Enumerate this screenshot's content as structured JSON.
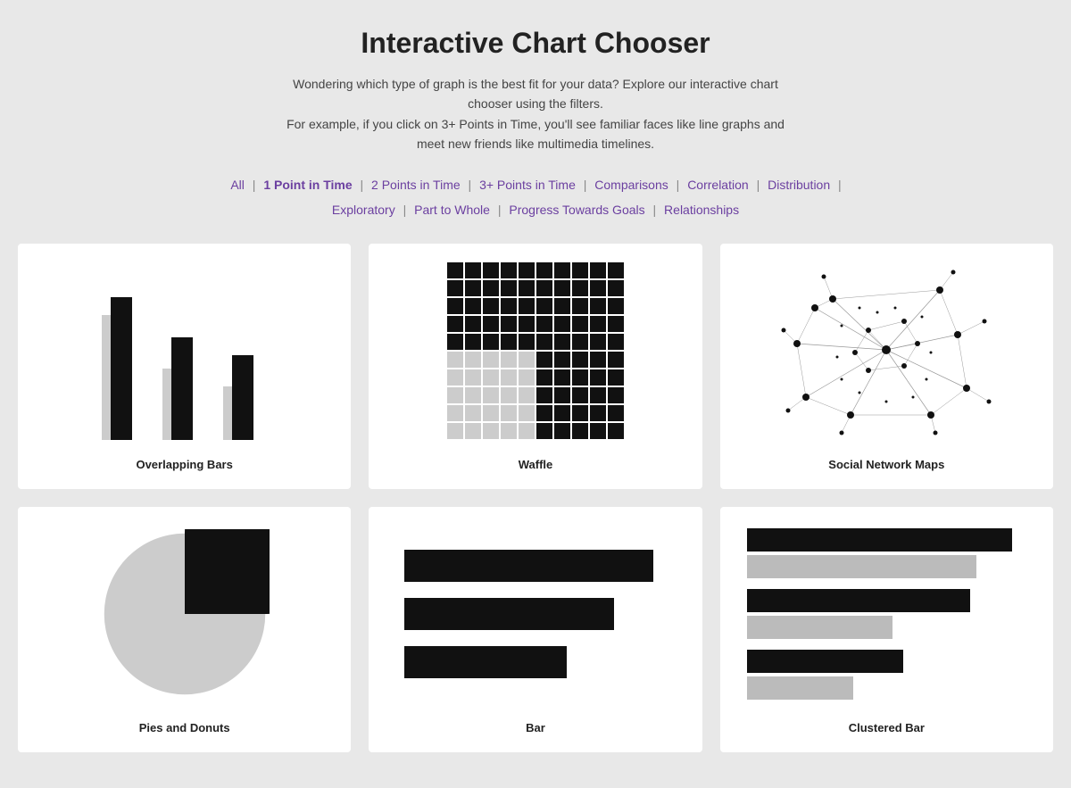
{
  "header": {
    "title": "Interactive Chart Chooser",
    "description_line1": "Wondering which type of graph is the best fit for your data? Explore our interactive chart chooser using the filters.",
    "description_line2": "For example, if you click on 3+ Points in Time, you'll see familiar faces like line graphs and meet new friends like multimedia timelines."
  },
  "filters": {
    "items": [
      {
        "label": "All",
        "active": false
      },
      {
        "label": "1 Point in Time",
        "active": true
      },
      {
        "label": "2 Points in Time",
        "active": false
      },
      {
        "label": "3+ Points in Time",
        "active": false
      },
      {
        "label": "Comparisons",
        "active": false
      },
      {
        "label": "Correlation",
        "active": false
      },
      {
        "label": "Distribution",
        "active": false
      },
      {
        "label": "Exploratory",
        "active": false
      },
      {
        "label": "Part to Whole",
        "active": false
      },
      {
        "label": "Progress Towards Goals",
        "active": false
      },
      {
        "label": "Relationships",
        "active": false
      }
    ]
  },
  "charts": [
    {
      "id": "overlapping-bars",
      "label": "Overlapping Bars"
    },
    {
      "id": "waffle",
      "label": "Waffle"
    },
    {
      "id": "social-network-maps",
      "label": "Social Network Maps"
    },
    {
      "id": "pies-and-donuts",
      "label": "Pies and Donuts"
    },
    {
      "id": "bar",
      "label": "Bar"
    },
    {
      "id": "clustered-bar",
      "label": "Clustered Bar"
    }
  ],
  "overlapping_bars": [
    {
      "back_height": 140,
      "front_height": 160
    },
    {
      "back_height": 80,
      "front_height": 110
    },
    {
      "back_height": 60,
      "front_height": 90
    }
  ],
  "waffle": {
    "filled_cells": [
      [
        0,
        0
      ],
      [
        0,
        1
      ],
      [
        0,
        2
      ],
      [
        0,
        3
      ],
      [
        0,
        4
      ],
      [
        0,
        5
      ],
      [
        0,
        6
      ],
      [
        0,
        7
      ],
      [
        0,
        8
      ],
      [
        0,
        9
      ],
      [
        1,
        0
      ],
      [
        1,
        1
      ],
      [
        1,
        2
      ],
      [
        1,
        3
      ],
      [
        1,
        4
      ],
      [
        1,
        5
      ],
      [
        1,
        6
      ],
      [
        1,
        7
      ],
      [
        1,
        8
      ],
      [
        1,
        9
      ],
      [
        2,
        0
      ],
      [
        2,
        1
      ],
      [
        2,
        2
      ],
      [
        2,
        3
      ],
      [
        2,
        4
      ],
      [
        2,
        5
      ],
      [
        2,
        6
      ],
      [
        2,
        7
      ],
      [
        2,
        8
      ],
      [
        2,
        9
      ],
      [
        3,
        0
      ],
      [
        3,
        1
      ],
      [
        3,
        2
      ],
      [
        3,
        3
      ],
      [
        3,
        4
      ],
      [
        3,
        5
      ],
      [
        3,
        6
      ],
      [
        3,
        7
      ],
      [
        3,
        8
      ],
      [
        3,
        9
      ],
      [
        4,
        0
      ],
      [
        4,
        1
      ],
      [
        4,
        2
      ],
      [
        4,
        3
      ],
      [
        4,
        4
      ],
      [
        4,
        5
      ],
      [
        4,
        6
      ],
      [
        4,
        7
      ],
      [
        4,
        8
      ],
      [
        4,
        9
      ],
      [
        5,
        5
      ],
      [
        5,
        6
      ],
      [
        5,
        7
      ],
      [
        5,
        8
      ],
      [
        5,
        9
      ],
      [
        6,
        5
      ],
      [
        6,
        6
      ],
      [
        6,
        7
      ],
      [
        6,
        8
      ],
      [
        6,
        9
      ],
      [
        7,
        5
      ],
      [
        7,
        6
      ],
      [
        7,
        7
      ],
      [
        7,
        8
      ],
      [
        7,
        9
      ],
      [
        8,
        5
      ],
      [
        8,
        6
      ],
      [
        8,
        7
      ],
      [
        8,
        8
      ],
      [
        8,
        9
      ],
      [
        9,
        5
      ],
      [
        9,
        6
      ],
      [
        9,
        7
      ],
      [
        9,
        8
      ],
      [
        9,
        9
      ]
    ]
  },
  "bar_chart": {
    "bars": [
      {
        "width_pct": 95
      },
      {
        "width_pct": 80
      },
      {
        "width_pct": 65
      }
    ]
  },
  "clustered_bar_chart": {
    "groups": [
      {
        "dark_pct": 95,
        "light_pct": 82
      },
      {
        "dark_pct": 80,
        "light_pct": 55
      },
      {
        "dark_pct": 58,
        "light_pct": 40
      }
    ]
  }
}
